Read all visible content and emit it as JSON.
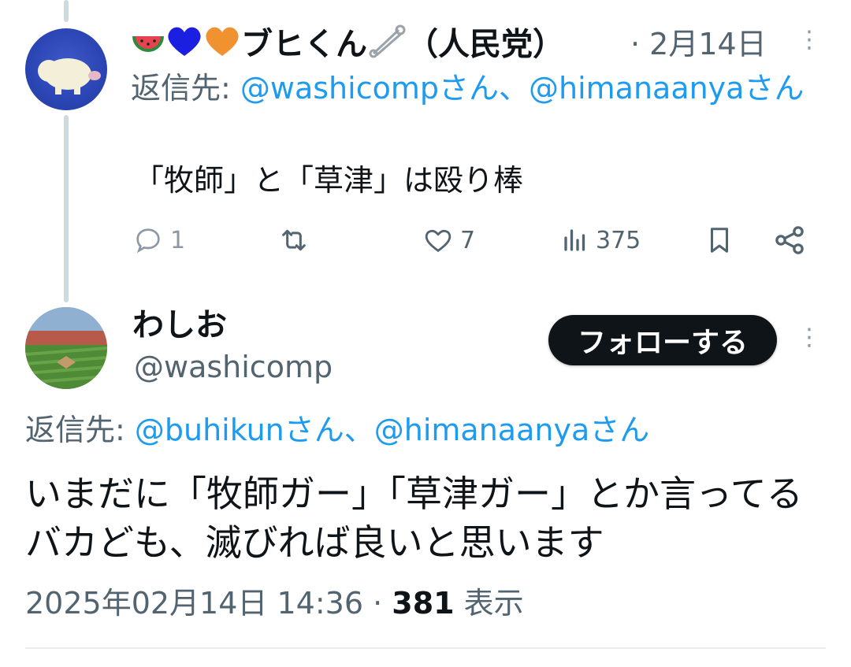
{
  "tweet1": {
    "emojis": [
      "watermelon-emoji",
      "blue-heart-emoji",
      "orange-heart-emoji"
    ],
    "display_name": "ブヒくん",
    "name_suffix": "（人民党）",
    "date": "· 2月14日",
    "reply_prefix": "返信先: ",
    "reply_mention_1": "@washicompさん",
    "reply_separator": "、",
    "reply_mention_2": "@himanaanyaさん",
    "text": "「牧師」と「草津」は殴り棒",
    "replies": "1",
    "likes": "7",
    "views": "375"
  },
  "tweet2": {
    "display_name": "わしお",
    "handle": "@washicomp",
    "follow_label": "フォローする",
    "reply_prefix": "返信先: ",
    "reply_mention_1": "@buhikunさん",
    "reply_separator": "、",
    "reply_mention_2": "@himanaanyaさん",
    "text": "いまだに「牧師ガー」「草津ガー」とか言ってるバカども、滅びれば良いと思います",
    "timestamp": "2025年02月14日 14:36 · ",
    "view_count": "381",
    "view_label": " 表示"
  },
  "colors": {
    "accent": "#1d9bf0",
    "muted": "#536471",
    "text": "#0f1419",
    "thread_line": "#cfd9de"
  }
}
